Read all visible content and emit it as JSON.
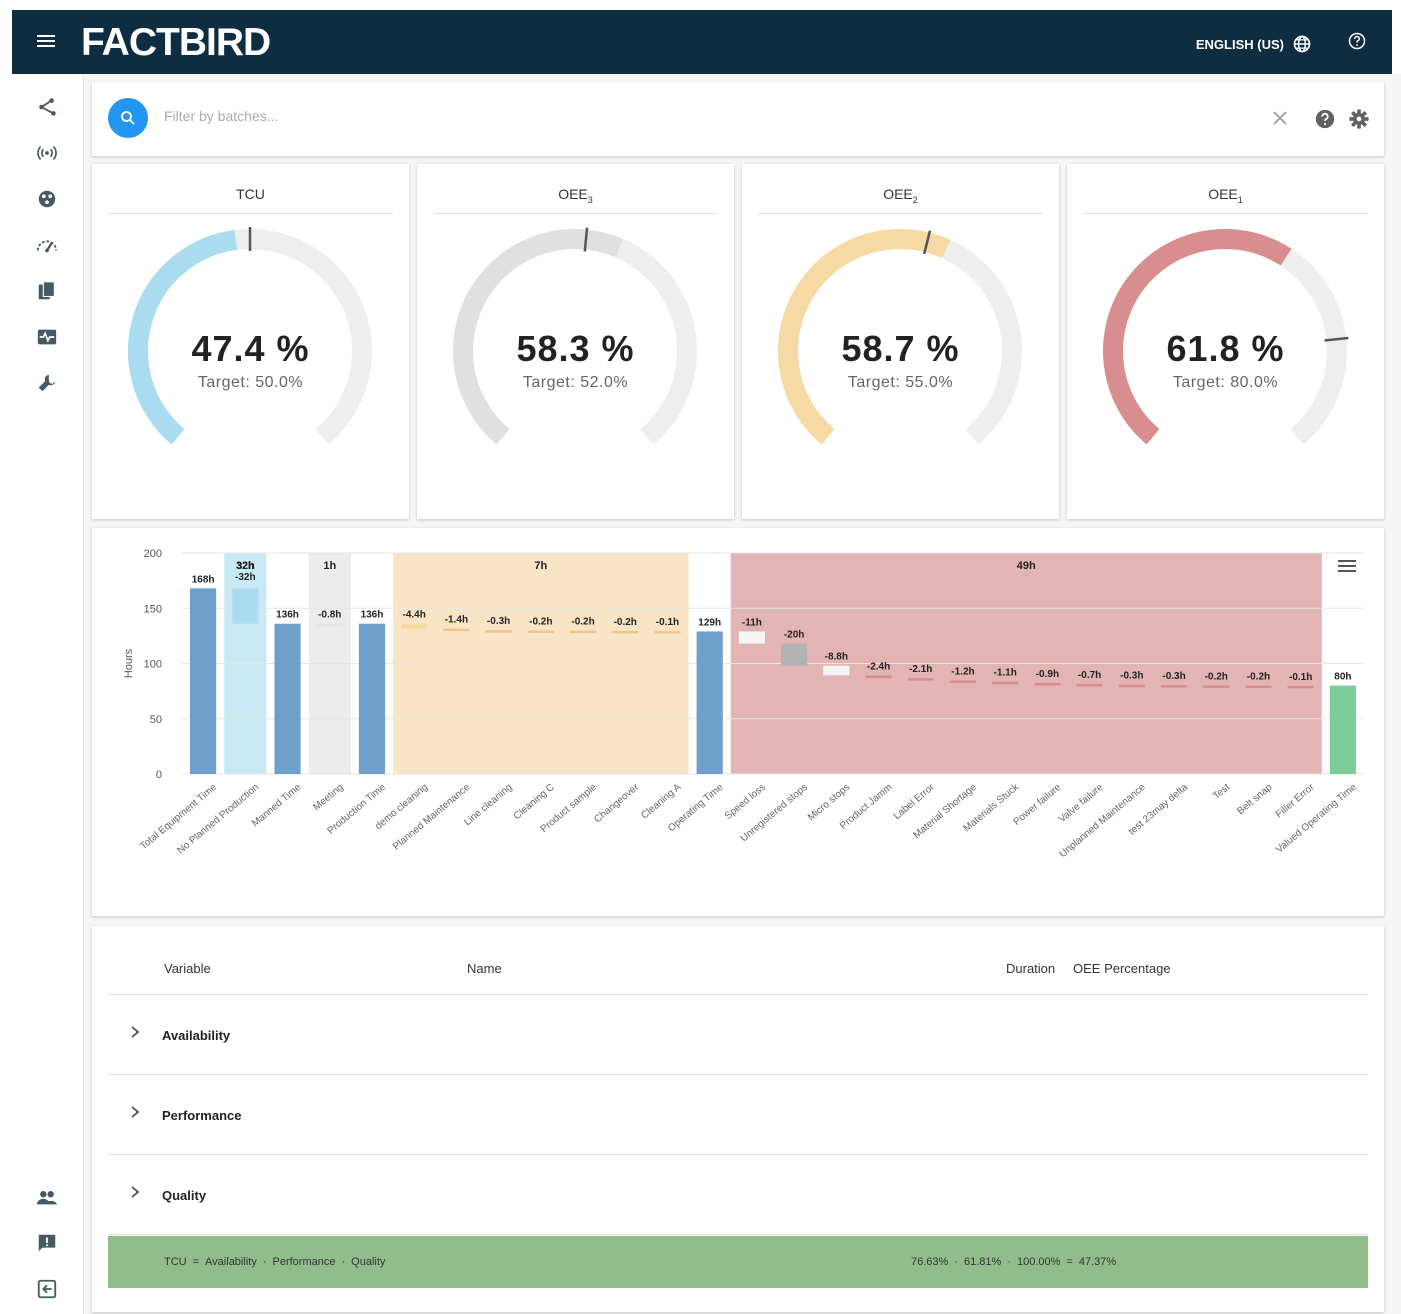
{
  "header": {
    "logo": "FACTBIRD",
    "language": "ENGLISH (US)"
  },
  "search": {
    "placeholder": "Filter by batches..."
  },
  "gauges": [
    {
      "title": "TCU",
      "sub": "",
      "value": "47.4 %",
      "target": "Target: 50.0%",
      "fraction": 0.474,
      "target_fraction": 0.5,
      "color": "#a9dcee"
    },
    {
      "title": "OEE",
      "sub": "3",
      "value": "58.3 %",
      "target": "Target: 52.0%",
      "fraction": 0.583,
      "target_fraction": 0.52,
      "color": "#e0e0e0"
    },
    {
      "title": "OEE",
      "sub": "2",
      "value": "58.7 %",
      "target": "Target: 55.0%",
      "fraction": 0.587,
      "target_fraction": 0.55,
      "color": "#f7d9a4"
    },
    {
      "title": "OEE",
      "sub": "1",
      "value": "61.8 %",
      "target": "Target: 80.0%",
      "fraction": 0.618,
      "target_fraction": 0.8,
      "color": "#d88e8e"
    }
  ],
  "chart_data": {
    "type": "bar",
    "ylabel": "Hours",
    "ylim": [
      0,
      200
    ],
    "yticks": [
      0,
      50,
      100,
      150,
      200
    ],
    "grid": true,
    "categories": [
      "Total Equipment Time",
      "No Planned Production",
      "Manned Time",
      "Meeting",
      "Production Time",
      "demo cleaning",
      "Planned Maintenance",
      "Line cleaning",
      "Cleaning C",
      "Product sample",
      "Changeover",
      "Cleaning A",
      "Operating Time",
      "Speed loss",
      "Unregistered stops",
      "Micro stops",
      "Product Jamm",
      "Label Error",
      "Material Shortage",
      "Materials Stuck",
      "Power failure",
      "Valve failure",
      "Unplanned Maintenance",
      "test 23may delta",
      "Test",
      "Belt snap",
      "Filler Error",
      "Valued Operating Time"
    ],
    "bars": [
      {
        "label": "168h",
        "low": 0,
        "high": 168,
        "color": "#6f9fcb"
      },
      {
        "label": "32h\n-32h",
        "low": 136,
        "high": 168,
        "color": "#a9dcee"
      },
      {
        "label": "136h",
        "low": 0,
        "high": 136,
        "color": "#6f9fcb"
      },
      {
        "label": "-0.8h",
        "low": 135.2,
        "high": 136,
        "color": "#e6e6e6"
      },
      {
        "label": "136h",
        "low": 0,
        "high": 136,
        "color": "#6f9fcb"
      },
      {
        "label": "-4.4h",
        "low": 131.6,
        "high": 136,
        "color": "#f7d9a4"
      },
      {
        "label": "-1.4h",
        "low": 130.2,
        "high": 131.6,
        "color": "#f0c58c"
      },
      {
        "label": "-0.3h",
        "low": 129.9,
        "high": 130.2,
        "color": "#f0c58c"
      },
      {
        "label": "-0.2h",
        "low": 129.7,
        "high": 129.9,
        "color": "#f0c58c"
      },
      {
        "label": "-0.2h",
        "low": 129.5,
        "high": 129.7,
        "color": "#f0c58c"
      },
      {
        "label": "-0.2h",
        "low": 129.3,
        "high": 129.5,
        "color": "#f0c58c"
      },
      {
        "label": "-0.1h",
        "low": 129.2,
        "high": 129.3,
        "color": "#f0c58c"
      },
      {
        "label": "129h",
        "low": 0,
        "high": 129,
        "color": "#6f9fcb"
      },
      {
        "label": "-11h",
        "low": 118,
        "high": 129,
        "color": "#f5f5f5"
      },
      {
        "label": "-20h",
        "low": 98,
        "high": 118,
        "color": "#b3b3b3"
      },
      {
        "label": "-8.8h",
        "low": 89.2,
        "high": 98,
        "color": "#f5f5f5"
      },
      {
        "label": "-2.4h",
        "low": 86.8,
        "high": 89.2,
        "color": "#d88e8e"
      },
      {
        "label": "-2.1h",
        "low": 84.7,
        "high": 86.8,
        "color": "#d88e8e"
      },
      {
        "label": "-1.2h",
        "low": 83.5,
        "high": 84.7,
        "color": "#d88e8e"
      },
      {
        "label": "-1.1h",
        "low": 82.4,
        "high": 83.5,
        "color": "#d88e8e"
      },
      {
        "label": "-0.9h",
        "low": 81.5,
        "high": 82.4,
        "color": "#d88e8e"
      },
      {
        "label": "-0.7h",
        "low": 80.8,
        "high": 81.5,
        "color": "#d88e8e"
      },
      {
        "label": "-0.3h",
        "low": 80.5,
        "high": 80.8,
        "color": "#d88e8e"
      },
      {
        "label": "-0.3h",
        "low": 80.2,
        "high": 80.5,
        "color": "#d88e8e"
      },
      {
        "label": "-0.2h",
        "low": 80.0,
        "high": 80.2,
        "color": "#d88e8e"
      },
      {
        "label": "-0.2h",
        "low": 79.8,
        "high": 80.0,
        "color": "#d88e8e"
      },
      {
        "label": "-0.1h",
        "low": 79.7,
        "high": 79.8,
        "color": "#d88e8e"
      },
      {
        "label": "80h",
        "low": 0,
        "high": 80,
        "color": "#7ccc9a"
      }
    ],
    "bands": [
      {
        "label": "32h",
        "from": 1,
        "to": 1,
        "color": "#c9e9f4"
      },
      {
        "label": "1h",
        "from": 3,
        "to": 3,
        "color": "#ececec"
      },
      {
        "label": "7h",
        "from": 5,
        "to": 11,
        "color": "#fae4c6"
      },
      {
        "label": "49h",
        "from": 13,
        "to": 26,
        "color": "#e3b4b4"
      }
    ]
  },
  "table": {
    "headers": {
      "variable": "Variable",
      "name": "Name",
      "duration": "Duration",
      "oee": "OEE Percentage"
    },
    "rows": [
      {
        "label": "Availability"
      },
      {
        "label": "Performance"
      },
      {
        "label": "Quality"
      }
    ],
    "summary": {
      "left_parts": [
        "TCU",
        "=",
        "Availability",
        "·",
        "Performance",
        "·",
        "Quality"
      ],
      "right_parts": [
        "76.63%",
        "·",
        "61.81%",
        "·",
        "100.00%",
        "=",
        "47.37%"
      ]
    }
  }
}
